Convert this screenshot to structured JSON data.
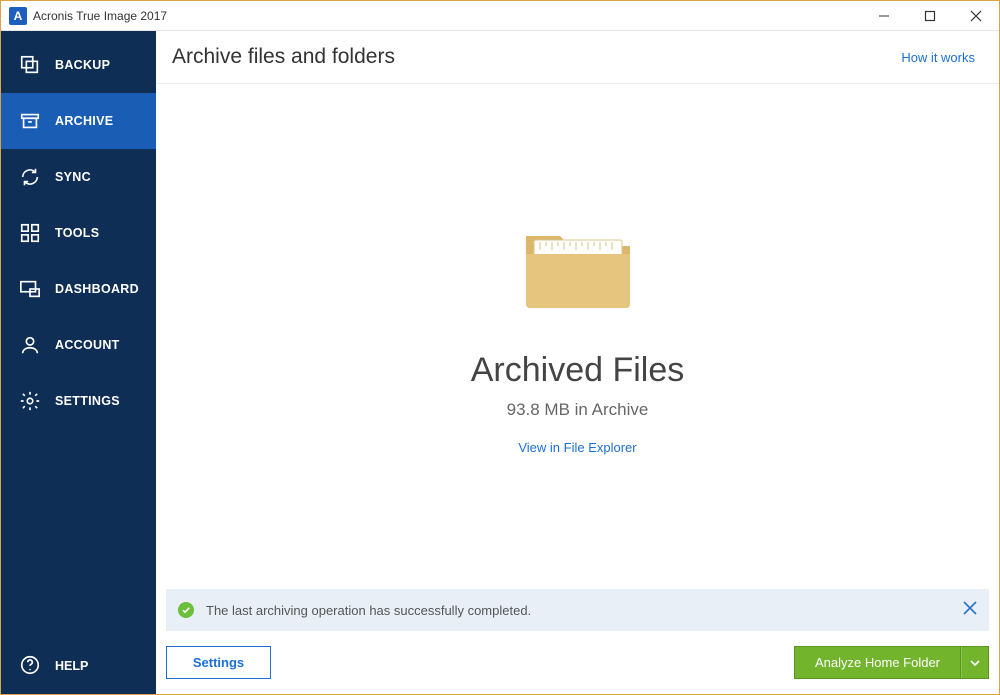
{
  "window": {
    "title": "Acronis True Image 2017",
    "app_icon_letter": "A"
  },
  "sidebar": {
    "items": [
      {
        "label": "BACKUP"
      },
      {
        "label": "ARCHIVE"
      },
      {
        "label": "SYNC"
      },
      {
        "label": "TOOLS"
      },
      {
        "label": "DASHBOARD"
      },
      {
        "label": "ACCOUNT"
      },
      {
        "label": "SETTINGS"
      }
    ],
    "help_label": "HELP"
  },
  "header": {
    "title": "Archive files and folders",
    "how_link": "How it works"
  },
  "content": {
    "big_title": "Archived Files",
    "sub_title": "93.8 MB in Archive",
    "view_link": "View in File Explorer"
  },
  "status": {
    "message": "The last archiving operation has successfully completed."
  },
  "bottom": {
    "settings_button": "Settings",
    "primary_button": "Analyze Home Folder"
  }
}
